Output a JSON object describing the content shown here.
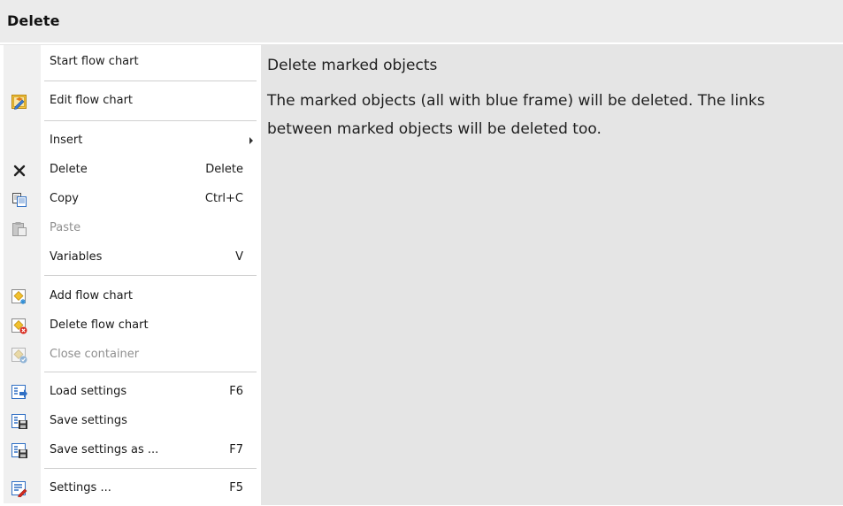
{
  "header": {
    "title": "Delete"
  },
  "description": {
    "title": "Delete marked objects",
    "body": "The marked objects (all with blue frame) will be deleted. The links between marked objects will be deleted too."
  },
  "menu": {
    "items": [
      {
        "label": "Start flow chart",
        "shortcut": "",
        "icon": "",
        "enabled": true
      },
      {
        "label": "Edit flow chart",
        "shortcut": "",
        "icon": "edit-flowchart-icon",
        "enabled": true
      },
      {
        "label": "Insert",
        "shortcut": "",
        "icon": "",
        "enabled": true,
        "submenu": true
      },
      {
        "label": "Delete",
        "shortcut": "Delete",
        "icon": "delete-x-icon",
        "enabled": true
      },
      {
        "label": "Copy",
        "shortcut": "Ctrl+C",
        "icon": "copy-icon",
        "enabled": true
      },
      {
        "label": "Paste",
        "shortcut": "",
        "icon": "paste-icon",
        "enabled": false
      },
      {
        "label": "Variables",
        "shortcut": "V",
        "icon": "",
        "enabled": true
      },
      {
        "label": "Add flow chart",
        "shortcut": "",
        "icon": "add-flowchart-icon",
        "enabled": true
      },
      {
        "label": "Delete flow chart",
        "shortcut": "",
        "icon": "delete-flowchart-icon",
        "enabled": true
      },
      {
        "label": "Close container",
        "shortcut": "",
        "icon": "close-container-icon",
        "enabled": false
      },
      {
        "label": "Load settings",
        "shortcut": "F6",
        "icon": "load-settings-icon",
        "enabled": true
      },
      {
        "label": "Save settings",
        "shortcut": "",
        "icon": "save-settings-icon",
        "enabled": true
      },
      {
        "label": "Save settings as ...",
        "shortcut": "F7",
        "icon": "save-settings-as-icon",
        "enabled": true
      },
      {
        "label": "Settings ...",
        "shortcut": "F5",
        "icon": "settings-icon",
        "enabled": true
      }
    ]
  },
  "colors": {
    "header_bg": "#ebebeb",
    "pane_bg": "#e5e5e5",
    "gutter_bg": "#f0f0f0",
    "disabled_text": "#8f8f8f",
    "icon_yellow": "#f2c12e",
    "icon_blue": "#2f6fc4",
    "icon_red": "#d9281c"
  }
}
